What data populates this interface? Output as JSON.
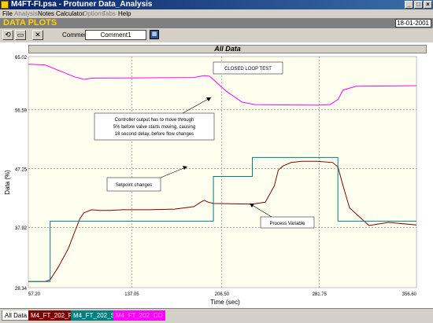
{
  "window": {
    "title": "M4FT-FI.psa - Protuner Data_Analysis"
  },
  "menu": [
    "File",
    "Analysis",
    "Notes",
    "Calculator",
    "Options",
    "Tabs",
    "Help"
  ],
  "header": {
    "title": "DATA PLOTS",
    "date": "18-01-2001"
  },
  "toolbar": {
    "comment_label": "Comment",
    "comment_value": "Comment1"
  },
  "plot": {
    "title": "All Data"
  },
  "annotations": {
    "closed_loop": "CLOSED LOOP TEST",
    "controller_note_1": "Controller output has to move through",
    "controller_note_2": "5% before valve starts moving, causing",
    "controller_note_3": "18 second delay, before flow changes",
    "setpoint": "Setpoint changes",
    "process": "Process Variable"
  },
  "tabs": [
    {
      "label": "All Data",
      "color": "#d4d0c8",
      "text_color": "#000000"
    },
    {
      "label": "M4_FT_202_PV",
      "color": "#800000",
      "text_color": "#ffffff"
    },
    {
      "label": "M4_FT_202_SP",
      "color": "#008080",
      "text_color": "#ffffff"
    },
    {
      "label": "M4_FT_202_CO",
      "color": "#ff00ff",
      "text_color": "#ff99ff"
    }
  ],
  "chart_data": {
    "type": "line",
    "title": "All Data",
    "xlabel": "Time (sec)",
    "ylabel": "Data (%)",
    "xlim": [
      57.2,
      356.6
    ],
    "ylim": [
      28.34,
      65.02
    ],
    "x_ticks": [
      "57.20",
      "137.05",
      "206.50",
      "281.75",
      "356.60"
    ],
    "y_ticks": [
      "28.34",
      "37.92",
      "47.25",
      "56.59",
      "65.02"
    ],
    "grid": true,
    "series": [
      {
        "name": "M4_FT_202_PV",
        "color": "#800000",
        "x": [
          57.2,
          70,
          74,
          80,
          88,
          93,
          97,
          100,
          106,
          112,
          120,
          130,
          150,
          170,
          185,
          190,
          193,
          196,
          200,
          230,
          240,
          247,
          250,
          254,
          260,
          268,
          280,
          292,
          296,
          300,
          305,
          320,
          335,
          356.6
        ],
        "y": [
          29.3,
          29.3,
          29.6,
          31.5,
          34.5,
          37.2,
          39.3,
          40.2,
          40.7,
          40.6,
          40.6,
          40.7,
          40.7,
          40.8,
          41.2,
          41.9,
          42.2,
          41.9,
          41.7,
          41.6,
          41.9,
          44.5,
          47.0,
          47.7,
          48.2,
          48.4,
          48.4,
          48.2,
          47.5,
          44.5,
          41.0,
          38.2,
          38.7,
          38.3
        ]
      },
      {
        "name": "M4_FT_202_SP",
        "color": "#008080",
        "x": [
          57.2,
          74,
          74,
          200,
          200,
          230,
          230,
          296,
          296,
          356.6
        ],
        "y": [
          29.3,
          29.3,
          38.9,
          38.9,
          46.0,
          46.0,
          49.0,
          49.0,
          38.9,
          38.9
        ]
      },
      {
        "name": "M4_FT_202_CO",
        "color": "#ff00ff",
        "x": [
          57.2,
          70,
          93,
          100,
          107,
          185,
          190,
          193,
          197,
          210,
          222,
          232,
          280,
          290,
          296,
          300,
          310,
          356.6
        ],
        "y": [
          63.8,
          63.7,
          61.8,
          61.4,
          61.6,
          61.7,
          61.9,
          62.0,
          61.9,
          59.5,
          57.8,
          57.4,
          57.3,
          57.4,
          58.2,
          59.7,
          60.3,
          60.4
        ]
      }
    ]
  }
}
